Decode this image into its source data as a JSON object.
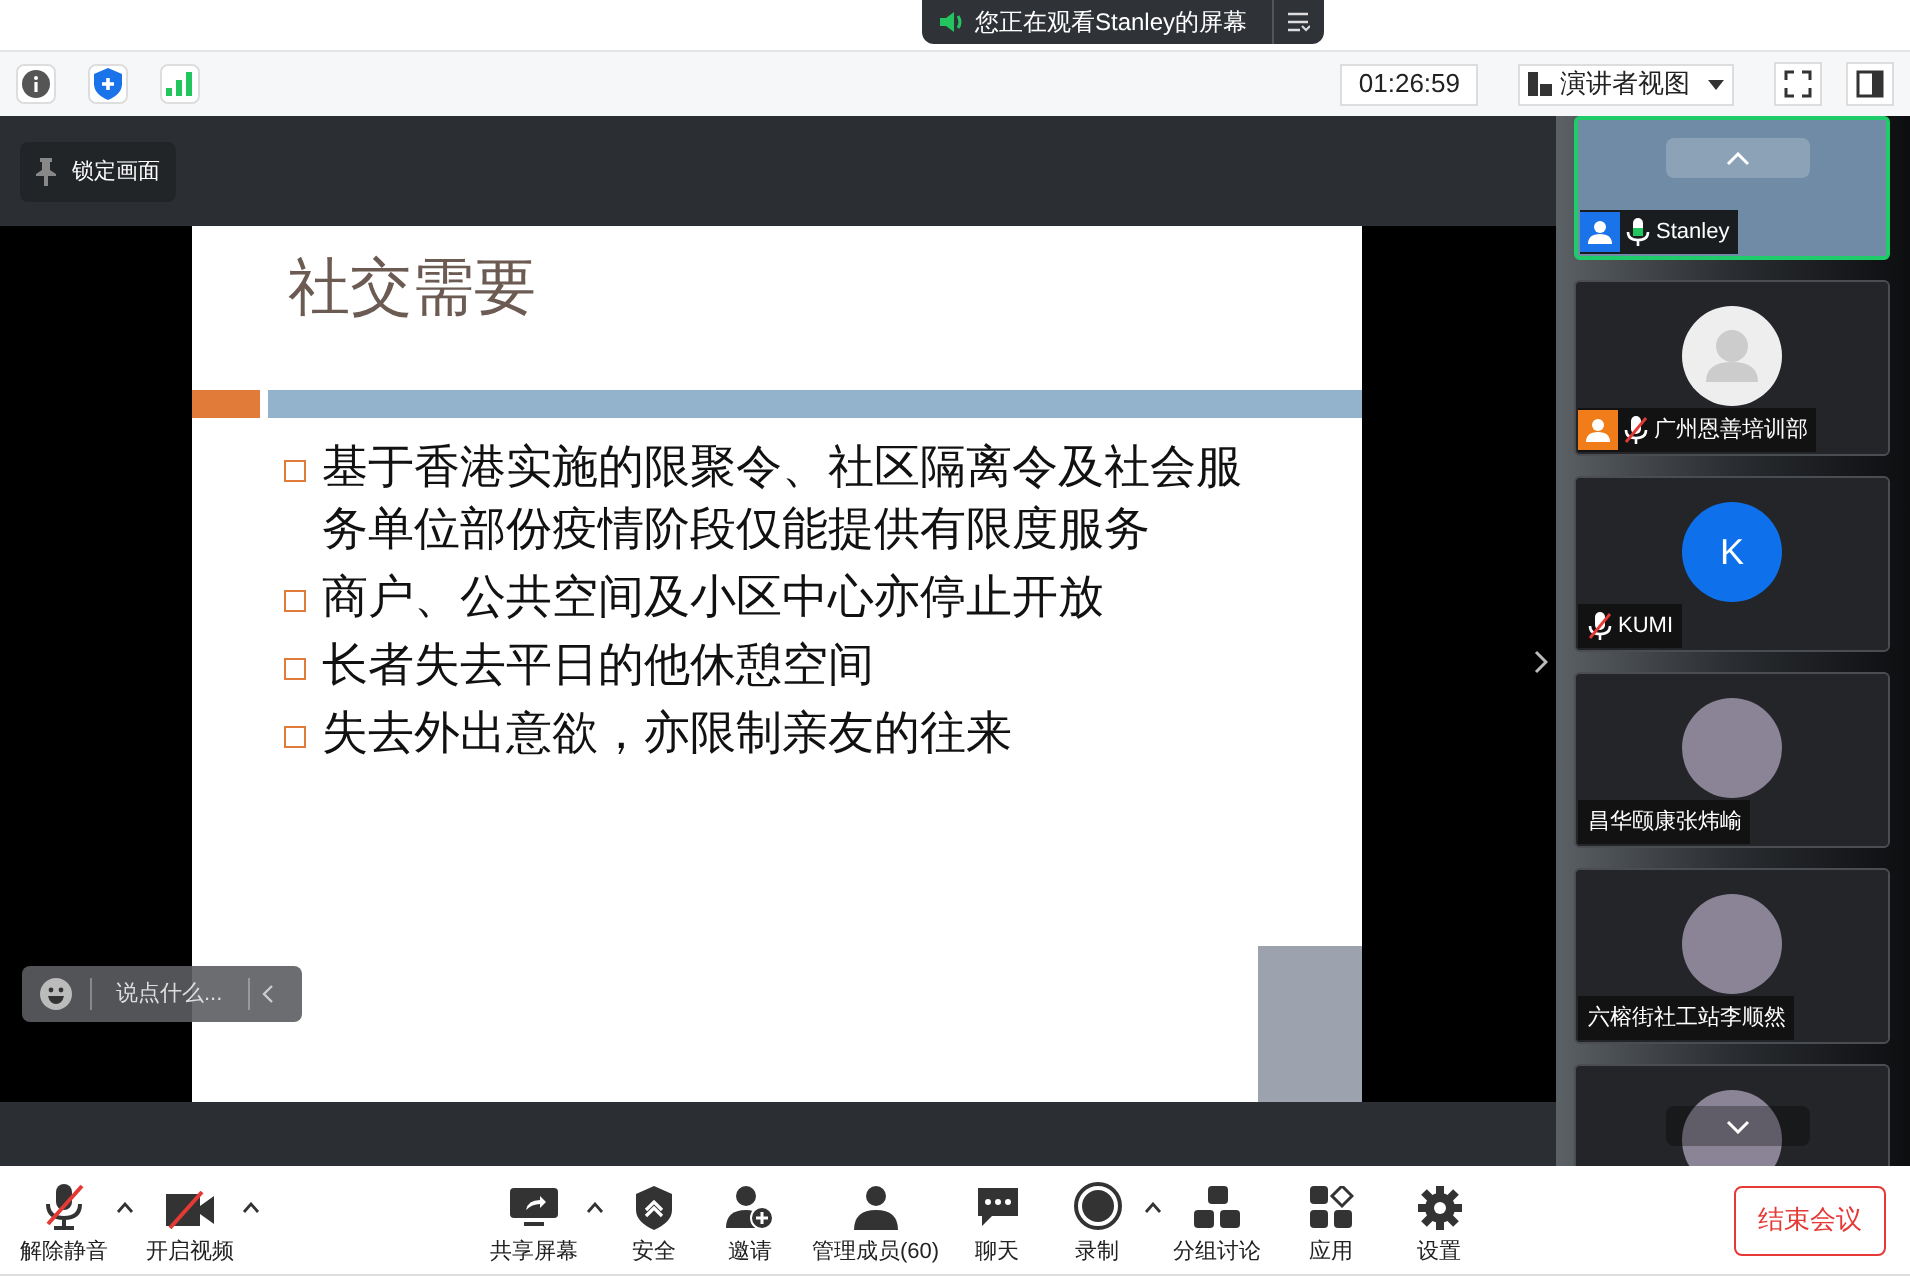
{
  "viewing_banner": {
    "text": "您正在观看Stanley的屏幕"
  },
  "top_toolbar": {
    "timer": "01:26:59",
    "view_menu": "演讲者视图"
  },
  "lock_button": "锁定画面",
  "slide": {
    "title": "社交需要",
    "bullets": [
      "基于香港实施的限聚令、社区隔离令及社会服务单位部份疫情阶段仅能提供有限度服务",
      "商户、公共空间及小区中心亦停止开放",
      "长者失去平日的他休憩空间",
      "失去外出意欲，亦限制亲友的往来"
    ]
  },
  "chat_input": {
    "placeholder": "说点什么..."
  },
  "participants": [
    {
      "kind": "video",
      "name": "Stanley",
      "color": "#1a73e8",
      "mic_muted": false,
      "active": true
    },
    {
      "kind": "default",
      "name": "广州恩善培训部",
      "color": "#f07c1a",
      "mic_muted": true,
      "active": false
    },
    {
      "kind": "initial",
      "initial": "K",
      "name": "KUMI",
      "mic_muted": true,
      "active": false
    },
    {
      "kind": "photo",
      "name": "昌华颐康张炜崳",
      "active": false
    },
    {
      "kind": "photo",
      "name": "六榕街社工站李顺然",
      "active": false
    },
    {
      "kind": "photo",
      "active": false
    }
  ],
  "bottom_toolbar": [
    {
      "kind": "mic",
      "label": "解除静音",
      "muted": true,
      "has_menu": true
    },
    {
      "kind": "video",
      "label": "开启视频",
      "muted": true,
      "has_menu": true
    },
    {
      "kind": "share",
      "label": "共享屏幕",
      "has_menu": true
    },
    {
      "kind": "security",
      "label": "安全",
      "has_menu": false
    },
    {
      "kind": "invite",
      "label": "邀请",
      "has_menu": false
    },
    {
      "kind": "members",
      "label": "管理成员(60)",
      "has_menu": false
    },
    {
      "kind": "chat",
      "label": "聊天",
      "has_menu": false
    },
    {
      "kind": "record",
      "label": "录制",
      "has_menu": true
    },
    {
      "kind": "breakout",
      "label": "分组讨论",
      "has_menu": false
    },
    {
      "kind": "apps",
      "label": "应用",
      "has_menu": false
    },
    {
      "kind": "settings",
      "label": "设置",
      "has_menu": false
    }
  ],
  "end_button": "结束会议"
}
